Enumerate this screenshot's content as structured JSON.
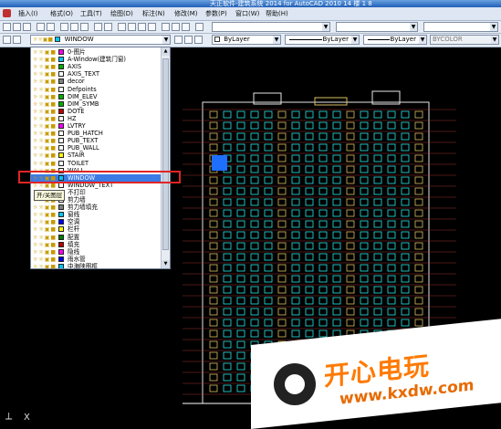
{
  "window": {
    "title": "天正软件-建筑系统 2014  for AutoCAD 2010    14 楼 1 8"
  },
  "menu": [
    "插入(I)",
    "格式(O)",
    "工具(T)",
    "绘图(D)",
    "标注(N)",
    "修改(M)",
    "参数(P)",
    "窗口(W)",
    "帮助(H)"
  ],
  "properties": {
    "current_layer": "WINDOW",
    "color": "ByLayer",
    "linetype": "ByLayer",
    "lineweight": "ByLayer",
    "plotstyle": "BYCOLOR"
  },
  "layers": [
    {
      "name": "0-图片",
      "color": "#ff00ff"
    },
    {
      "name": "A-Window(建筑门窗)",
      "color": "#00c8ff"
    },
    {
      "name": "AXIS",
      "color": "#00b000"
    },
    {
      "name": "AXIS_TEXT",
      "color": "#ffffff"
    },
    {
      "name": "decor",
      "color": "#808080"
    },
    {
      "name": "Defpoints",
      "color": "#ffffff"
    },
    {
      "name": "DIM_ELEV",
      "color": "#00b000"
    },
    {
      "name": "DIM_SYMB",
      "color": "#00b000"
    },
    {
      "name": "DOTE",
      "color": "#c00000"
    },
    {
      "name": "HZ",
      "color": "#ffffff"
    },
    {
      "name": "LVTRY",
      "color": "#ff00ff"
    },
    {
      "name": "PUB_HATCH",
      "color": "#ffffff"
    },
    {
      "name": "PUB_TEXT",
      "color": "#ffffff"
    },
    {
      "name": "PUB_WALL",
      "color": "#ffffff"
    },
    {
      "name": "STAIR",
      "color": "#ffff00"
    },
    {
      "name": "TOILET",
      "color": "#ffffff"
    },
    {
      "name": "WALL",
      "color": "#ffffff"
    },
    {
      "name": "WINDOW",
      "color": "#00c8ff",
      "selected": true
    },
    {
      "name": "WINDOW_TEXT",
      "color": "#ffffff"
    },
    {
      "name": "不打印",
      "color": "#ffffff"
    },
    {
      "name": "剪力墙",
      "color": "#ffffff"
    },
    {
      "name": "剪力墙填充",
      "color": "#808080"
    },
    {
      "name": "窗线",
      "color": "#00c8ff"
    },
    {
      "name": "空调",
      "color": "#0000ff"
    },
    {
      "name": "栏杆",
      "color": "#ffff00"
    },
    {
      "name": "配置",
      "color": "#008000"
    },
    {
      "name": "填充",
      "color": "#c00000"
    },
    {
      "name": "隐线",
      "color": "#ff00ff"
    },
    {
      "name": "雨水管",
      "color": "#0000ff"
    },
    {
      "name": "中海陕图框",
      "color": "#00c8ff"
    }
  ],
  "tooltip": "开/关图层",
  "watermark": {
    "title": "开心电玩",
    "url": "www.kxdw.com"
  },
  "colors": {
    "accent": "#3b7be6",
    "highlight": "#e02525",
    "canvas": "#000000"
  }
}
